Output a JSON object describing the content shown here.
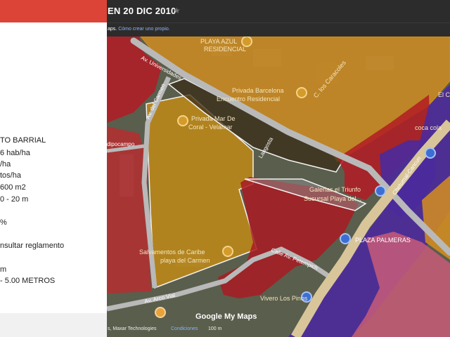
{
  "header": {
    "title": "EN 20 DIC 2010",
    "info_text": "aps.",
    "info_link": "Cómo crear uno propio."
  },
  "panel": {
    "lines": [
      "TO BARRIAL",
      "6 hab/ha",
      "/ha",
      "tos/ha",
      "600 m2",
      "0 - 20 m",
      "%",
      "nsultar reglamento",
      "m",
      "- 5.00 METROS"
    ]
  },
  "map": {
    "labels": {
      "playa_azul": "PLAYA AZUL",
      "residencial": "RESIDENCIAL",
      "privada_barcelona": "Privada Barcelona",
      "encuentro_residencial": "Encuentro Residencial",
      "los_caracoles": "C. los Caracoles",
      "el_c": "El C",
      "coca_cola": "coca cola",
      "av_universidades": "Av. Universidades",
      "av_del_carmen": "Av. del Carmen",
      "privada_mar": "Privada Mar De",
      "coral_velamar": "Coral - Velamar",
      "dipocampo": "dipocampo",
      "langosta": "Langosta",
      "galerias_1": "Galerias el Triunfo",
      "galerias_2": "Sucursal Playa del...",
      "chetumal": "Chetumal-Cancun",
      "plaza_palmeras": "PLAZA PALMERAS",
      "calle_av": "Calle Av. Petempich",
      "salvamentos_1": "Salvamentos de Caribe",
      "salvamentos_2": "playa del Carmen",
      "vivero": "Vivero Los Pinos",
      "av_arco_vial": "Av. Arco Vial"
    },
    "attribution": "s, Maxar Technologies",
    "terms": "Condiciones",
    "scale": "100 m",
    "logo": "Google My Maps"
  },
  "colors": {
    "red_zone": "#b31b24",
    "orange_zone": "#d68e1e",
    "purple_zone": "#4b2a9c",
    "pink_zone": "#c85a78",
    "road": "#b9b9b9",
    "header_bg": "#2c2c2c",
    "brand_red": "#db4437"
  }
}
